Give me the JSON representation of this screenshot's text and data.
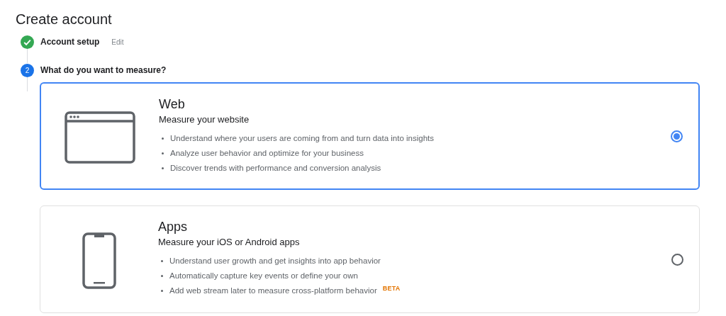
{
  "title": "Create account",
  "steps": [
    {
      "kind": "done",
      "label": "Account setup",
      "edit": "Edit"
    },
    {
      "kind": "current",
      "number": "2",
      "label": "What do you want to measure?"
    }
  ],
  "options": [
    {
      "kind": "web",
      "title": "Web",
      "subtitle": "Measure your website",
      "selected": true,
      "bullets": [
        {
          "text": "Understand where your users are coming from and turn data into insights"
        },
        {
          "text": "Analyze user behavior and optimize for your business"
        },
        {
          "text": "Discover trends with performance and conversion analysis"
        }
      ]
    },
    {
      "kind": "apps",
      "title": "Apps",
      "subtitle": "Measure your iOS or Android apps",
      "selected": false,
      "bullets": [
        {
          "text": "Understand user growth and get insights into app behavior"
        },
        {
          "text": "Automatically capture key events or define your own"
        },
        {
          "text": "Add web stream later to measure cross-platform behavior",
          "badge": "BETA"
        }
      ]
    }
  ]
}
